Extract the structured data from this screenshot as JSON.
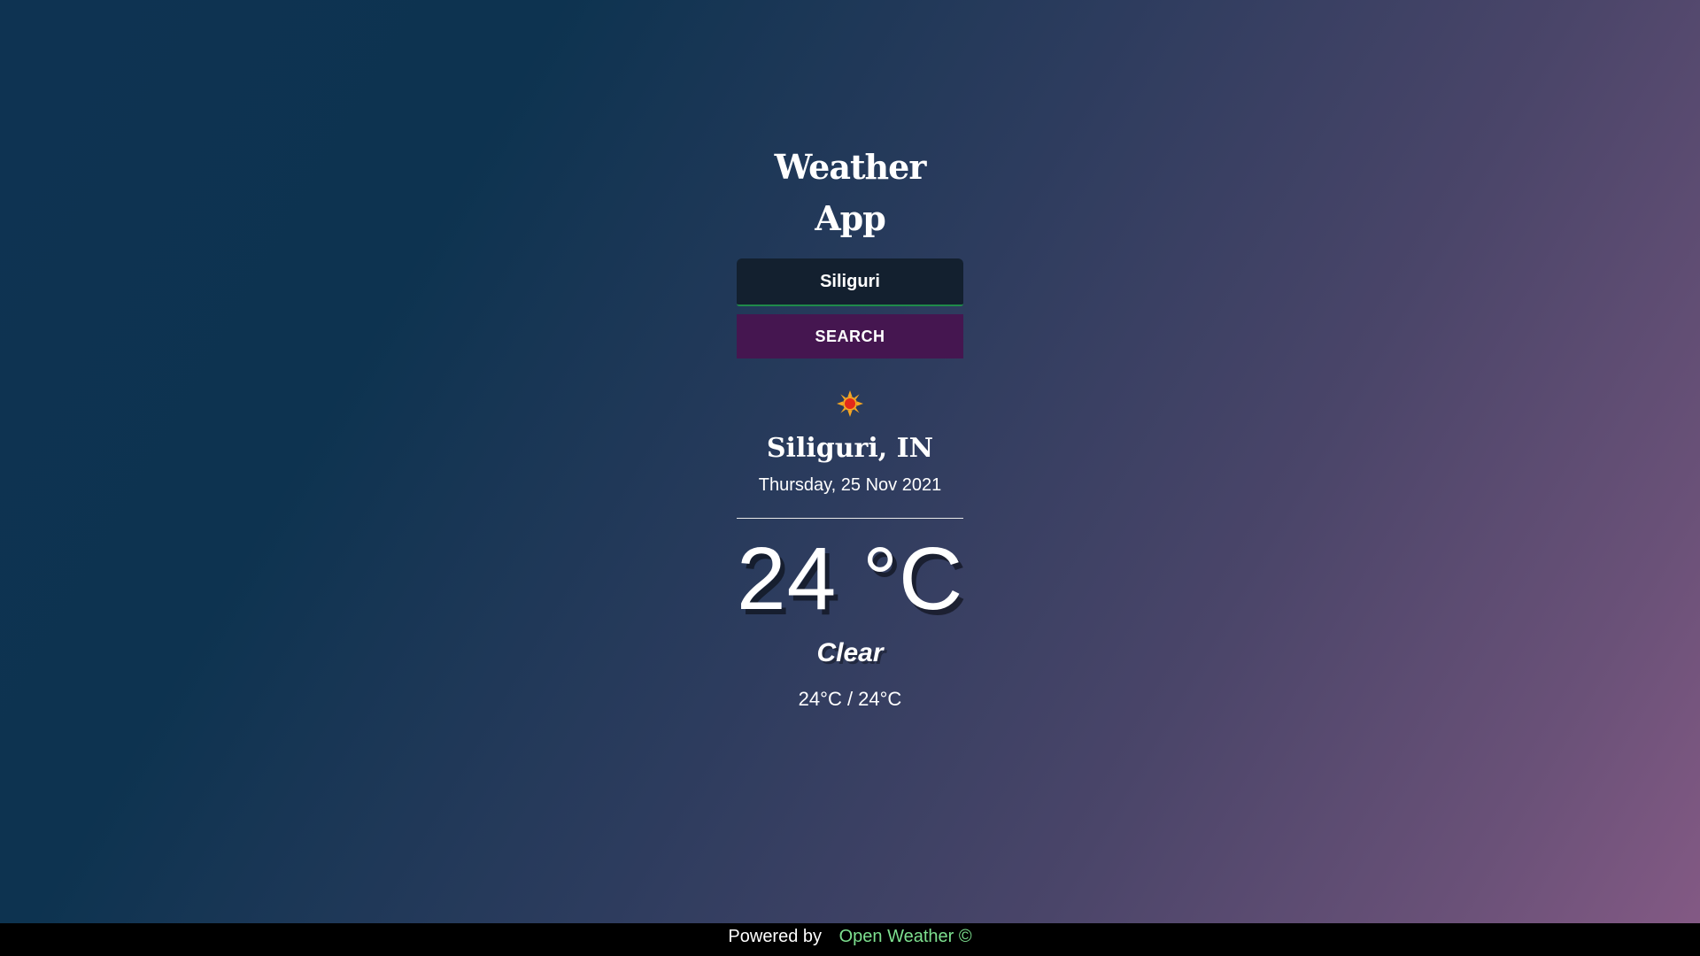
{
  "app": {
    "title": "Weather App"
  },
  "search": {
    "value": "Siliguri",
    "button_label": "SEARCH"
  },
  "weather": {
    "icon": "sun-icon",
    "location": "Siliguri, IN",
    "date": "Thursday, 25 Nov 2021",
    "temperature": "24 °C",
    "condition": "Clear",
    "range": "24°C / 24°C"
  },
  "footer": {
    "powered_by": "Powered by",
    "provider": "Open Weather ©",
    "provider_color": "#7de08f"
  },
  "colors": {
    "button_bg": "#451650",
    "input_bg": "#13202f",
    "input_border": "#1f8a4a",
    "sun_core": "#e32a1a",
    "sun_rays": "#f5a623"
  }
}
